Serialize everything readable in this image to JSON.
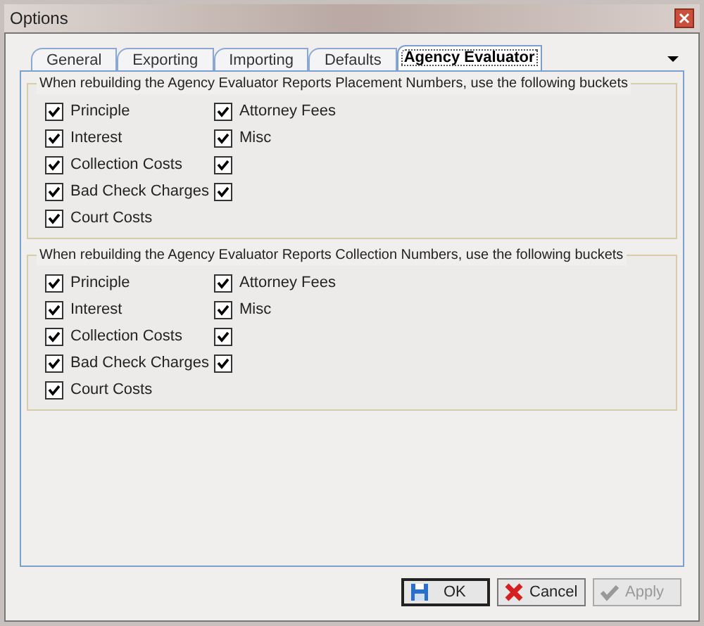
{
  "window": {
    "title": "Options"
  },
  "tabs": [
    {
      "label": "General",
      "selected": false
    },
    {
      "label": "Exporting",
      "selected": false
    },
    {
      "label": "Importing",
      "selected": false
    },
    {
      "label": "Defaults",
      "selected": false
    },
    {
      "label": "Agency Evaluator",
      "selected": true
    }
  ],
  "groups": [
    {
      "legend": "When rebuilding the Agency Evaluator Reports Placement Numbers, use the following buckets",
      "columns": [
        [
          {
            "label": "Principle",
            "checked": true
          },
          {
            "label": "Interest",
            "checked": true
          },
          {
            "label": "Collection Costs",
            "checked": true
          },
          {
            "label": "Bad Check Charges",
            "checked": true
          },
          {
            "label": "Court Costs",
            "checked": true
          }
        ],
        [
          {
            "label": "Attorney Fees",
            "checked": true
          },
          {
            "label": "Misc",
            "checked": true
          },
          {
            "checked": true
          },
          {
            "checked": true
          }
        ]
      ]
    },
    {
      "legend": "When rebuilding the Agency Evaluator Reports Collection Numbers, use the following buckets",
      "columns": [
        [
          {
            "label": "Principle",
            "checked": true
          },
          {
            "label": "Interest",
            "checked": true
          },
          {
            "label": "Collection Costs",
            "checked": true
          },
          {
            "label": "Bad Check Charges",
            "checked": true
          },
          {
            "label": "Court Costs",
            "checked": true
          }
        ],
        [
          {
            "label": "Attorney Fees",
            "checked": true
          },
          {
            "label": "Misc",
            "checked": true
          },
          {
            "checked": true
          },
          {
            "checked": true
          }
        ]
      ]
    }
  ],
  "buttons": [
    {
      "kind": "ok",
      "label": "OK",
      "disabled": false
    },
    {
      "kind": "cancel",
      "label": "Cancel",
      "disabled": false
    },
    {
      "kind": "apply",
      "label": "Apply",
      "disabled": true
    }
  ]
}
